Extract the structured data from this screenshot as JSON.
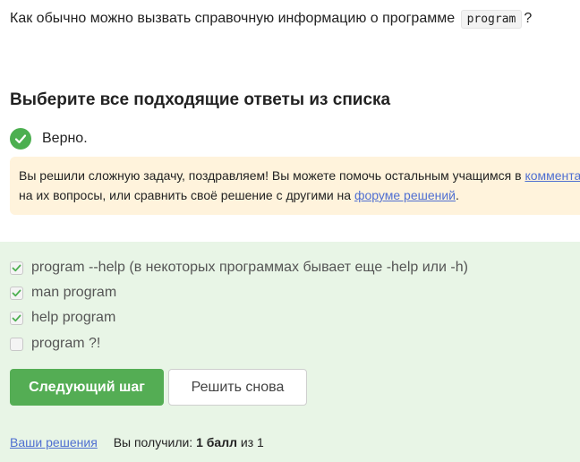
{
  "question": {
    "text_before": "Как обычно можно вызвать справочную информацию о программе",
    "code": "program",
    "text_after": "?"
  },
  "section_title": "Выберите все подходящие ответы из списка",
  "verdict": {
    "text": "Верно.",
    "icon": "check-circle-icon",
    "color": "#4caf50"
  },
  "notice": {
    "line1_text": "Вы решили сложную задачу, поздравляем! Вы можете помочь остальным учащимся в ",
    "line1_link": "комментариях",
    "line2_text": "на их вопросы, или сравнить своё решение с другими на ",
    "line2_link": "форуме решений",
    "line2_end": "."
  },
  "options": [
    {
      "label": "program --help (в некоторых программах бывает еще -help или -h)",
      "checked": true
    },
    {
      "label": "man program",
      "checked": true
    },
    {
      "label": "help program",
      "checked": true
    },
    {
      "label": "program ?!",
      "checked": false
    }
  ],
  "buttons": {
    "next": "Следующий шаг",
    "retry": "Решить снова"
  },
  "footer": {
    "solutions_link": "Ваши решения",
    "result_prefix": "Вы получили:",
    "score": "1 балл",
    "result_suffix": "из 1"
  },
  "colors": {
    "accent_green": "#54ad54",
    "answers_bg": "#e8f5e6",
    "notice_bg": "#fff3dc",
    "link": "#4f6fd1"
  }
}
